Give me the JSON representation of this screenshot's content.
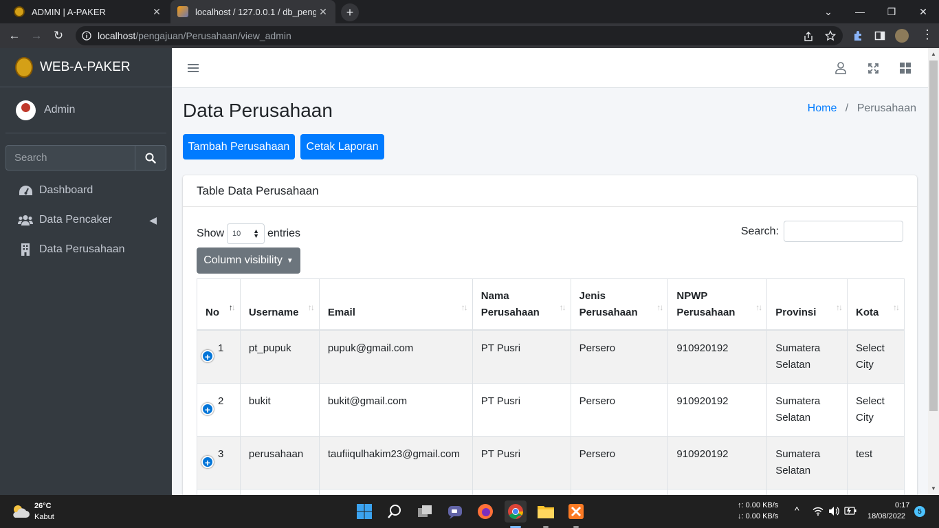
{
  "browser": {
    "tabs": [
      {
        "title": "ADMIN | A-PAKER",
        "active": false
      },
      {
        "title": "localhost / 127.0.0.1 / db_pengajuan",
        "active": true
      }
    ],
    "url_host": "localhost",
    "url_path": "/pengajuan/Perusahaan/view_admin"
  },
  "sidebar": {
    "brand": "WEB-A-PAKER",
    "user": "Admin",
    "search_placeholder": "Search",
    "items": [
      {
        "label": "Dashboard",
        "icon": "gauge-icon"
      },
      {
        "label": "Data Pencaker",
        "icon": "users-icon"
      },
      {
        "label": "Data Perusahaan",
        "icon": "building-icon"
      }
    ]
  },
  "page": {
    "title": "Data Perusahaan",
    "breadcrumb_home": "Home",
    "breadcrumb_sep": "/",
    "breadcrumb_current": "Perusahaan",
    "btn_add": "Tambah Perusahaan",
    "btn_print": "Cetak Laporan"
  },
  "card": {
    "title": "Table Data Perusahaan",
    "show_label": "Show",
    "entries_value": "10",
    "entries_label": "entries",
    "search_label": "Search:",
    "colvis_label": "Column visibility"
  },
  "table": {
    "headers": [
      "No",
      "Username",
      "Email",
      "Nama Perusahaan",
      "Jenis Perusahaan",
      "NPWP Perusahaan",
      "Provinsi",
      "Kota"
    ],
    "rows": [
      [
        "1",
        "pt_pupuk",
        "pupuk@gmail.com",
        "PT Pusri",
        "Persero",
        "910920192",
        "Sumatera Selatan",
        "Select City"
      ],
      [
        "2",
        "bukit",
        "bukit@gmail.com",
        "PT Pusri",
        "Persero",
        "910920192",
        "Sumatera Selatan",
        "Select City"
      ],
      [
        "3",
        "perusahaan",
        "taufiiqulhakim23@gmail.com",
        "PT Pusri",
        "Persero",
        "910920192",
        "Sumatera Selatan",
        "test"
      ]
    ]
  },
  "taskbar": {
    "temp": "26°C",
    "weather": "Kabut",
    "net_up": "↑: 0.00 KB/s",
    "net_down": "↓: 0.00 KB/s",
    "time": "0:17",
    "date": "18/08/2022",
    "notif_count": "5"
  }
}
